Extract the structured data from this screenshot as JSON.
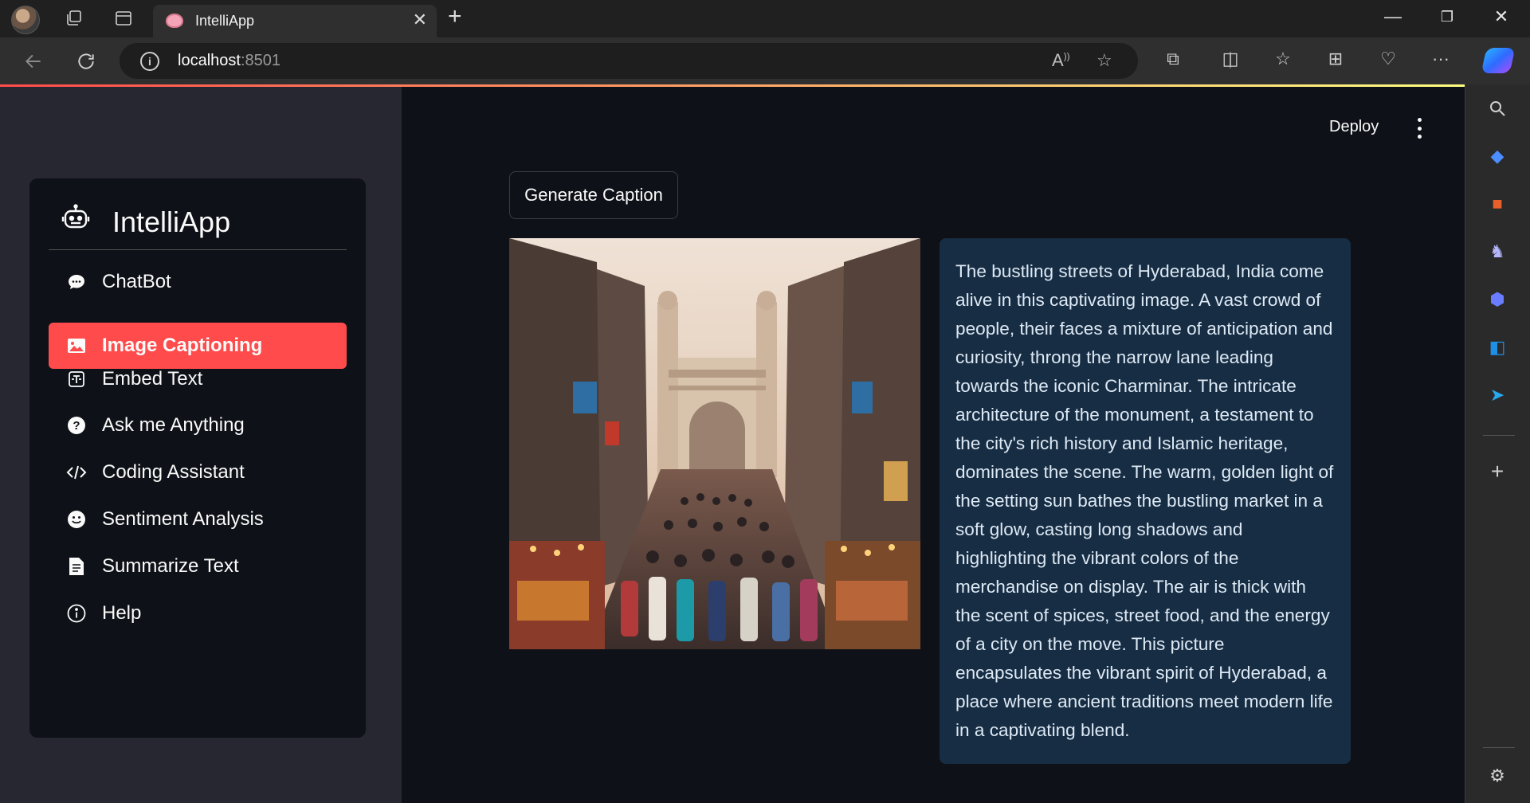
{
  "browser": {
    "tab_title": "IntelliApp",
    "url_host": "localhost",
    "url_port": ":8501"
  },
  "sidebar": {
    "app_title": "IntelliApp",
    "items": [
      {
        "label": "ChatBot",
        "icon": "chat-bubble-icon",
        "active": false
      },
      {
        "label": "Image Captioning",
        "icon": "image-icon",
        "active": true
      },
      {
        "label": "Embed Text",
        "icon": "embed-text-icon",
        "active": false
      },
      {
        "label": "Ask me Anything",
        "icon": "question-circle-icon",
        "active": false
      },
      {
        "label": "Coding Assistant",
        "icon": "code-icon",
        "active": false
      },
      {
        "label": "Sentiment Analysis",
        "icon": "smiley-icon",
        "active": false
      },
      {
        "label": "Summarize Text",
        "icon": "document-icon",
        "active": false
      },
      {
        "label": "Help",
        "icon": "info-circle-icon",
        "active": false
      }
    ]
  },
  "header": {
    "deploy_label": "Deploy"
  },
  "main": {
    "generate_button": "Generate Caption",
    "image_alt": "Crowded market street leading to the Charminar",
    "caption": "The bustling streets of Hyderabad, India come alive in this captivating image. A vast crowd of people, their faces a mixture of anticipation and curiosity, throng the narrow lane leading towards the iconic Charminar. The intricate architecture of the monument, a testament to the city's rich history and Islamic heritage, dominates the scene. The warm, golden light of the setting sun bathes the bustling market in a soft glow, casting long shadows and highlighting the vibrant colors of the merchandise on display. The air is thick with the scent of spices, street food, and the energy of a city on the move. This picture encapsulates the vibrant spirit of Hyderabad, a place where ancient traditions meet modern life in a captivating blend."
  },
  "colors": {
    "accent": "#ff4b4b",
    "background": "#0e1117",
    "sidebar_bg": "#262730",
    "caption_bg": "#172d43"
  }
}
